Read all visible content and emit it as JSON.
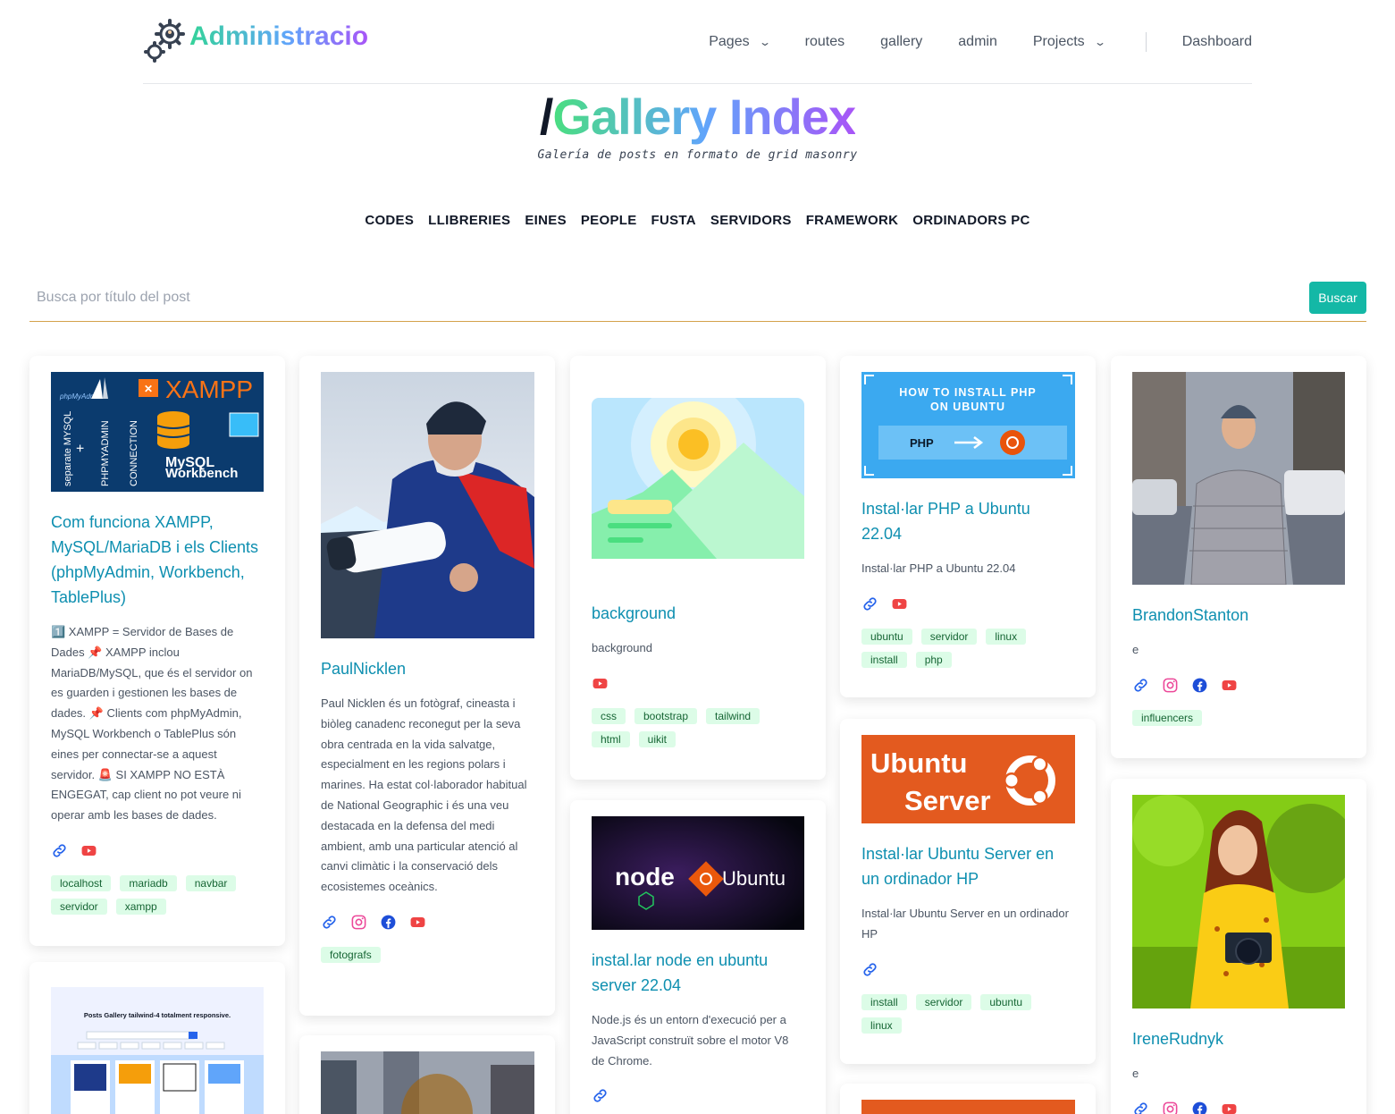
{
  "header": {
    "logo_text": "Administracio",
    "nav": [
      {
        "label": "Pages",
        "dropdown": true
      },
      {
        "label": "routes",
        "dropdown": false
      },
      {
        "label": "gallery",
        "dropdown": false
      },
      {
        "label": "admin",
        "dropdown": false
      },
      {
        "label": "Projects",
        "dropdown": true
      }
    ],
    "dashboard": "Dashboard"
  },
  "title": {
    "slash": "/",
    "text": "Gallery Index"
  },
  "subtitle": "Galería de posts en formato de grid masonry",
  "categories": [
    "CODES",
    "LLIBRERIES",
    "EINES",
    "PEOPLE",
    "FUSTA",
    "SERVIDORS",
    "FRAMEWORK",
    "ORDINADORS PC"
  ],
  "search": {
    "placeholder": "Busca por título del post",
    "button": "Buscar"
  },
  "colors": {
    "accent": "#14b8a6",
    "title": "#0e8fb0",
    "tag_bg": "#dcfce7",
    "tag_text": "#166534"
  },
  "cards": {
    "xampp": {
      "thumb_text": "XAMPP",
      "thumb_sub": "MySQL Workbench",
      "thumb_vertical": "separate MYSQL + PHPMYADMIN CONNECTION",
      "title": "Com funciona XAMPP, MySQL/MariaDB i els Clients (phpMyAdmin, Workbench, TablePlus)",
      "desc": "1️⃣ XAMPP = Servidor de Bases de Dades 📌 XAMPP inclou MariaDB/MySQL, que és el servidor on es guarden i gestionen les bases de dades. 📌 Clients com phpMyAdmin, MySQL Workbench o TablePlus són eines per connectar-se a aquest servidor. 🚨 SI XAMPP NO ESTÀ ENGEGAT, cap client no pot veure ni operar amb les bases de dades.",
      "icons": [
        "link-icon",
        "youtube-icon"
      ],
      "tags": [
        "localhost",
        "mariadb",
        "navbar",
        "servidor",
        "xampp"
      ]
    },
    "paul": {
      "title": "PaulNicklen",
      "desc": "Paul Nicklen és un fotògraf, cineasta i biòleg canadenc reconegut per la seva obra centrada en la vida salvatge, especialment en les regions polars i marines. Ha estat col·laborador habitual de National Geographic i és una veu destacada en la defensa del medi ambient, amb una particular atenció al canvi climàtic i la conservació dels ecosistemes oceànics.",
      "icons": [
        "link-icon",
        "instagram-icon",
        "facebook-icon",
        "youtube-icon"
      ],
      "tags": [
        "fotografs"
      ]
    },
    "background": {
      "title": "background",
      "desc": "background",
      "icons": [
        "youtube-icon"
      ],
      "tags": [
        "css",
        "bootstrap",
        "tailwind",
        "html",
        "uikit"
      ]
    },
    "node": {
      "thumb_text": "node",
      "thumb_sub": "Ubuntu",
      "title": "instal.lar node en ubuntu server 22.04",
      "desc": "Node.js és un entorn d'execució per a JavaScript construït sobre el motor V8 de Chrome."
    },
    "php": {
      "thumb_title": "HOW TO INSTALL PHP ON UBUNTU",
      "thumb_php": "PHP",
      "title": "Instal·lar PHP a Ubuntu 22.04",
      "desc": "Instal·lar PHP a Ubuntu 22.04",
      "icons": [
        "link-icon",
        "youtube-icon"
      ],
      "tags": [
        "ubuntu",
        "servidor",
        "linux",
        "install",
        "php"
      ]
    },
    "ubuntu_server": {
      "thumb_line1": "Ubuntu",
      "thumb_line2": "Server",
      "title": "Instal·lar Ubuntu Server en un ordinador HP",
      "desc": "Instal·lar Ubuntu Server en un ordinador HP",
      "icons": [
        "link-icon"
      ],
      "tags": [
        "install",
        "servidor",
        "ubuntu",
        "linux"
      ]
    },
    "brandon": {
      "title": "BrandonStanton",
      "desc": "e",
      "icons": [
        "link-icon",
        "instagram-icon",
        "facebook-icon",
        "youtube-icon"
      ],
      "tags": [
        "influencers"
      ]
    },
    "irene": {
      "title": "IreneRudnyk",
      "desc": "e"
    },
    "gallery_shot": {
      "thumb_title": "Posts Gallery tailwind-4 totalment responsive."
    }
  }
}
